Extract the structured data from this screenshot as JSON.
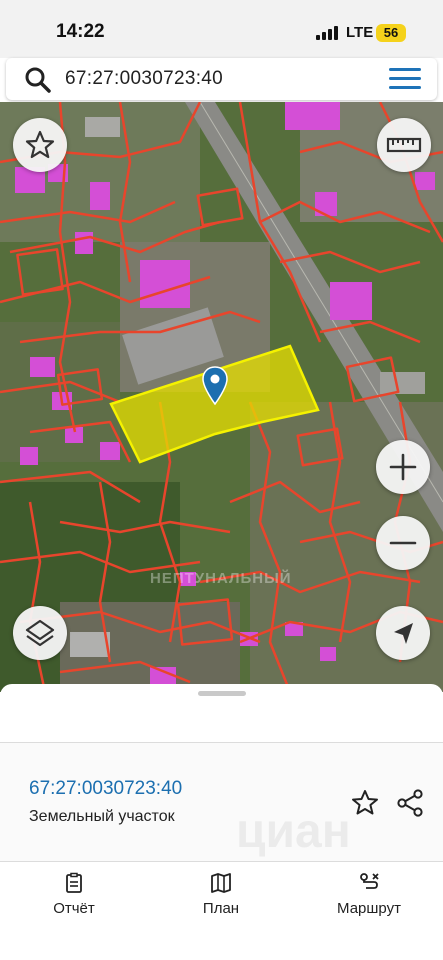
{
  "status": {
    "time": "14:22",
    "network": "LTE",
    "battery": "56"
  },
  "search": {
    "query": "67:27:0030723:40",
    "icon": "search-icon",
    "menu_icon": "hamburger-menu-icon"
  },
  "map": {
    "buttons": {
      "favorite": "star-icon",
      "ruler": "ruler-icon",
      "zoom_in": "plus-icon",
      "zoom_out": "minus-icon",
      "layers": "layers-icon",
      "locate": "navigation-arrow-icon"
    },
    "watermark": "НЕПТУНАЛЬНЫЙ",
    "parcel_color": "#e8e000",
    "boundary_color": "#e8452c",
    "building_color": "#d44fd6",
    "marker_color": "#1c6fb0"
  },
  "sheet": {
    "cadastral_number": "67:27:0030723:40",
    "object_type": "Земельный участок",
    "watermark": "циан"
  },
  "tabs": [
    {
      "label": "Отчёт",
      "icon": "report-icon"
    },
    {
      "label": "План",
      "icon": "map-icon"
    },
    {
      "label": "Маршрут",
      "icon": "route-icon"
    }
  ]
}
